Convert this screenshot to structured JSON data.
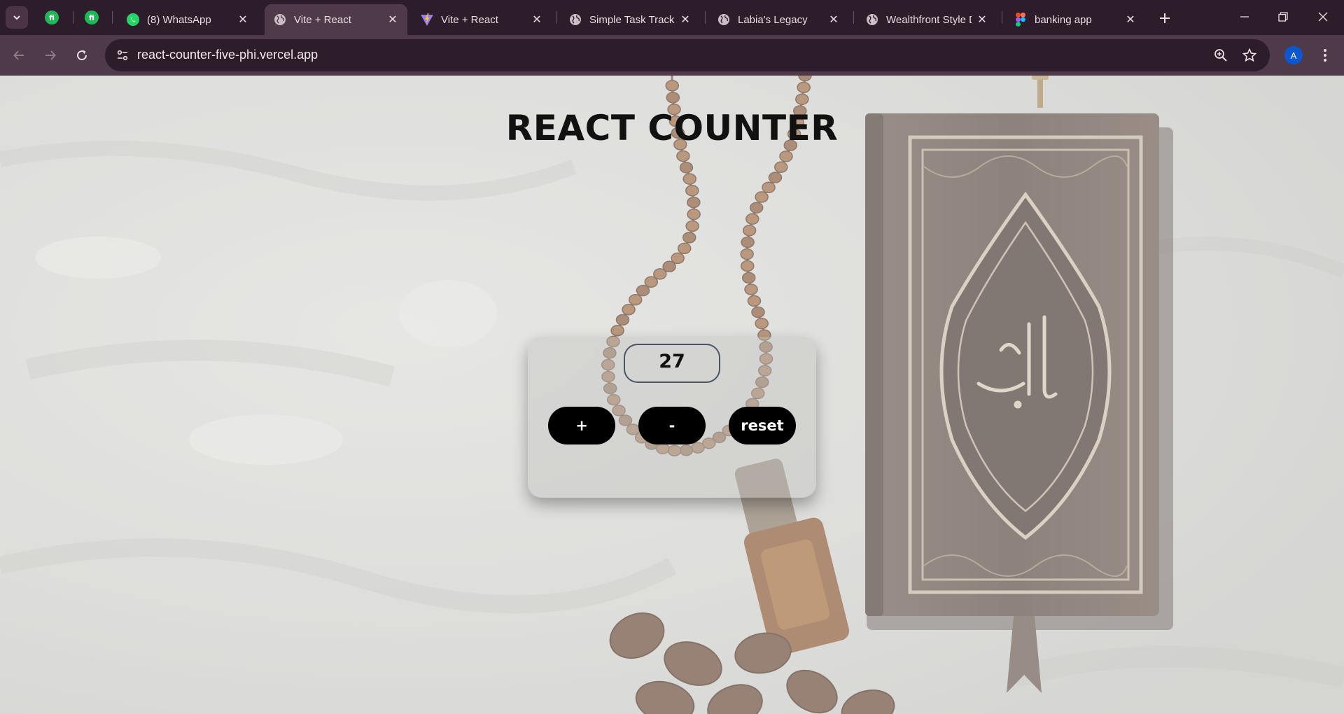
{
  "browser": {
    "tabs": [
      {
        "title": "(8) WhatsApp",
        "icon": "whatsapp-icon",
        "active": false
      },
      {
        "title": "Vite + React",
        "icon": "globe-icon",
        "active": true
      },
      {
        "title": "Vite + React",
        "icon": "vite-icon",
        "active": false
      },
      {
        "title": "Simple Task Tracker",
        "icon": "globe-icon",
        "active": false
      },
      {
        "title": "Labia's Legacy",
        "icon": "globe-icon",
        "active": false
      },
      {
        "title": "Wealthfront Style Dashboard",
        "icon": "globe-icon",
        "active": false
      },
      {
        "title": "banking app",
        "icon": "figma-icon",
        "active": false
      }
    ],
    "pinned_tab_logo": "fi",
    "url": "react-counter-five-phi.vercel.app",
    "profile_initial": "A",
    "colors": {
      "frame": "#2d1c29",
      "toolbar": "#4e3a49",
      "avatar": "#0b57d0"
    }
  },
  "page": {
    "title": "REACT COUNTER",
    "count": "27",
    "buttons": {
      "increment": "+",
      "decrement": "-",
      "reset": "reset"
    }
  }
}
